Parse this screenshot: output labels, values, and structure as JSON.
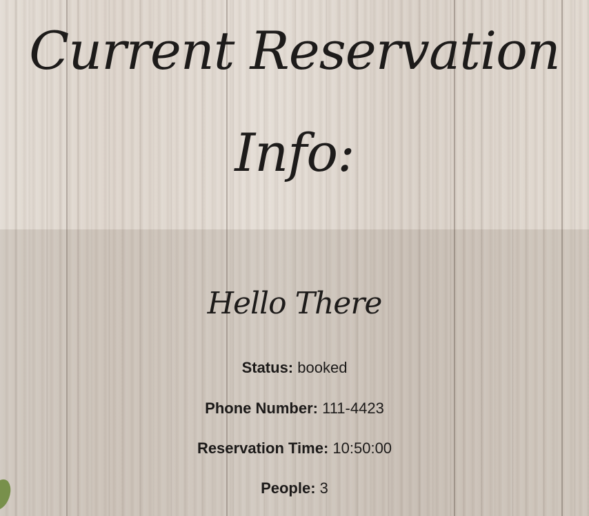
{
  "page": {
    "title": "Current Reservation Info:"
  },
  "greeting": "Hello There",
  "details": {
    "status_label": "Status:",
    "status_value": "booked",
    "phone_label": "Phone Number:",
    "phone_value": "111-4423",
    "time_label": "Reservation Time:",
    "time_value": "10:50:00",
    "people_label": "People:",
    "people_value": "3"
  },
  "colors": {
    "text": "#1d1b1a",
    "background": "#ddd5cc",
    "panel_overlay": "rgba(90,75,65,0.13)",
    "leaf": "#7d9a4e"
  }
}
